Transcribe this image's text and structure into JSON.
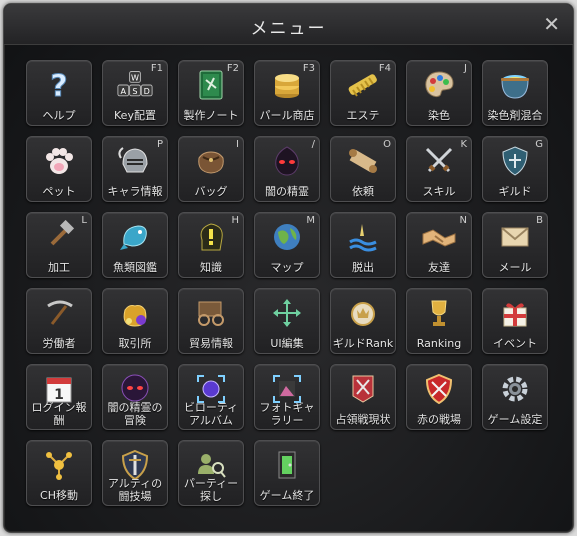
{
  "window": {
    "title": "メニュー",
    "close_glyph": "✕"
  },
  "tiles": [
    {
      "label": "ヘルプ",
      "key": ""
    },
    {
      "label": "Key配置",
      "key": "F1"
    },
    {
      "label": "製作ノート",
      "key": "F2"
    },
    {
      "label": "パール商店",
      "key": "F3"
    },
    {
      "label": "エステ",
      "key": "F4"
    },
    {
      "label": "染色",
      "key": "J"
    },
    {
      "label": "染色剤混合",
      "key": ""
    },
    {
      "label": "ペット",
      "key": ""
    },
    {
      "label": "キャラ情報",
      "key": "P"
    },
    {
      "label": "バッグ",
      "key": "I"
    },
    {
      "label": "闇の精霊",
      "key": "/"
    },
    {
      "label": "依頼",
      "key": "O"
    },
    {
      "label": "スキル",
      "key": "K"
    },
    {
      "label": "ギルド",
      "key": "G"
    },
    {
      "label": "加工",
      "key": "L"
    },
    {
      "label": "魚類図鑑",
      "key": ""
    },
    {
      "label": "知識",
      "key": "H"
    },
    {
      "label": "マップ",
      "key": "M"
    },
    {
      "label": "脱出",
      "key": ""
    },
    {
      "label": "友達",
      "key": "N"
    },
    {
      "label": "メール",
      "key": "B"
    },
    {
      "label": "労働者",
      "key": ""
    },
    {
      "label": "取引所",
      "key": ""
    },
    {
      "label": "貿易情報",
      "key": ""
    },
    {
      "label": "UI編集",
      "key": ""
    },
    {
      "label": "ギルドRank",
      "key": ""
    },
    {
      "label": "Ranking",
      "key": ""
    },
    {
      "label": "イベント",
      "key": ""
    },
    {
      "label": "ログイン報\n酬",
      "key": ""
    },
    {
      "label": "闇の精霊の\n冒険",
      "key": ""
    },
    {
      "label": "ビローティ\nアルバム",
      "key": ""
    },
    {
      "label": "フォトギャ\nラリー",
      "key": ""
    },
    {
      "label": "占領戦現状",
      "key": ""
    },
    {
      "label": "赤の戦場",
      "key": ""
    },
    {
      "label": "ゲーム設定",
      "key": ""
    },
    {
      "label": "CH移動",
      "key": ""
    },
    {
      "label": "アルティの\n闘技場",
      "key": ""
    },
    {
      "label": "パーティー\n探し",
      "key": ""
    },
    {
      "label": "ゲーム終了",
      "key": ""
    }
  ],
  "icon_keys": {
    "w": "W",
    "a": "A",
    "s": "S",
    "d": "D",
    "calendar_day": "1"
  },
  "colors": {
    "accent_gold": "#d8b04a",
    "label_text": "#e6e6e6",
    "tile_border": "#4e4e50"
  }
}
